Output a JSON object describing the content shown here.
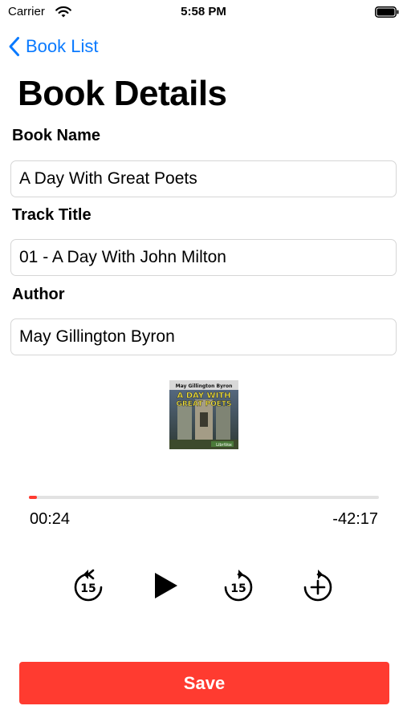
{
  "status_bar": {
    "carrier": "Carrier",
    "time": "5:58 PM"
  },
  "nav": {
    "back_label": "Book List"
  },
  "page": {
    "title": "Book Details"
  },
  "form": {
    "book_name": {
      "label": "Book Name",
      "value": "A Day With Great Poets"
    },
    "track_title": {
      "label": "Track Title",
      "value": "01 - A Day With John Milton"
    },
    "author": {
      "label": "Author",
      "value": "May Gillington Byron"
    }
  },
  "cover": {
    "author_text": "May Gillington Byron",
    "title_line1": "A DAY WITH",
    "title_line2": "GREAT POETS",
    "publisher": "LibriVox"
  },
  "player": {
    "elapsed": "00:24",
    "remaining": "-42:17",
    "progress_fraction": 0.023,
    "skip_back_seconds": "15",
    "skip_forward_seconds": "15"
  },
  "actions": {
    "save_label": "Save"
  },
  "colors": {
    "accent": "#ff3b30",
    "link": "#0a7aff"
  }
}
